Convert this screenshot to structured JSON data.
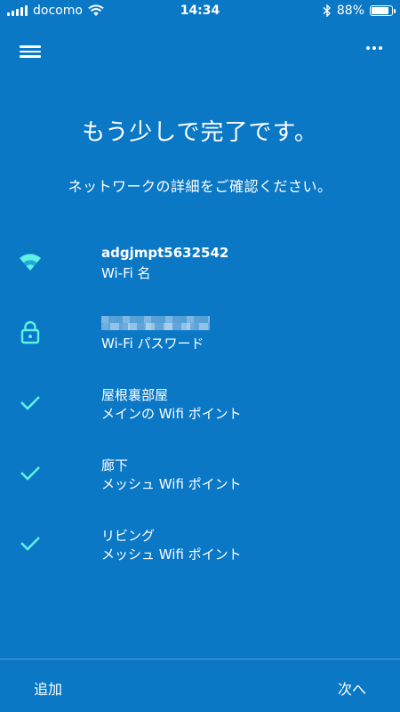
{
  "status_bar": {
    "carrier": "docomo",
    "time": "14:34",
    "battery_percent_label": "88%",
    "battery_level": 0.88,
    "icons": [
      "signal-icon",
      "wifi-icon",
      "bluetooth-icon",
      "battery-icon"
    ]
  },
  "header": {
    "menu_icon": "menu-icon",
    "more_icon": "more-horizontal-icon"
  },
  "title": "もう少しで完了です。",
  "subtitle": "ネットワークの詳細をご確認ください。",
  "items": [
    {
      "icon": "wifi-icon",
      "primary": "adgjmpt5632542",
      "secondary": "Wi-Fi 名"
    },
    {
      "icon": "lock-icon",
      "primary": "",
      "secondary": "Wi-Fi パスワード"
    },
    {
      "icon": "check-icon",
      "primary": "屋根裏部屋",
      "secondary": "メインの Wifi ポイント"
    },
    {
      "icon": "check-icon",
      "primary": "廊下",
      "secondary": "メッシュ Wifi ポイント"
    },
    {
      "icon": "check-icon",
      "primary": "リビング",
      "secondary": "メッシュ Wifi ポイント"
    }
  ],
  "footer": {
    "add_label": "追加",
    "next_label": "次へ"
  },
  "colors": {
    "background": "#0b78c6",
    "accent_icon": "#5ff0e4",
    "text": "#ffffff"
  }
}
